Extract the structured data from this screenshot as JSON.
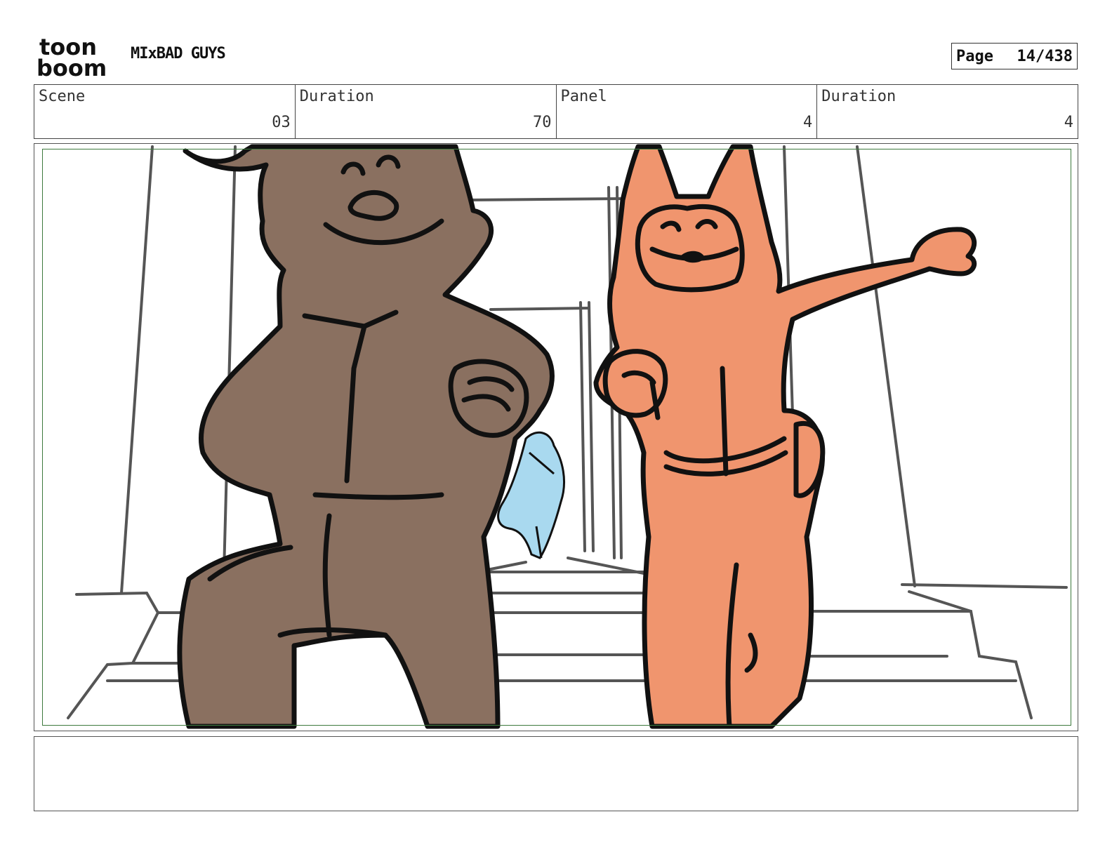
{
  "header": {
    "logo_text_top": "toon",
    "logo_text_bottom": "boom",
    "project_title": "MIxBAD GUYS",
    "page_label": "Page",
    "page_number": "14/438"
  },
  "info": {
    "scene_label": "Scene",
    "scene_value": "03",
    "scene_duration_label": "Duration",
    "scene_duration_value": "70",
    "panel_label": "Panel",
    "panel_value": "4",
    "panel_duration_label": "Duration",
    "panel_duration_value": "4"
  },
  "panel": {
    "characters": [
      "wolf",
      "fox",
      "background-figure"
    ],
    "colors": {
      "wolf_fill": "#8a7060",
      "fox_fill": "#f0956e",
      "figure_fill": "#a9d9ef",
      "safe_area": "#3d7a3d",
      "ink": "#111111",
      "set_lines": "#555555"
    }
  },
  "notes": {
    "text": ""
  }
}
